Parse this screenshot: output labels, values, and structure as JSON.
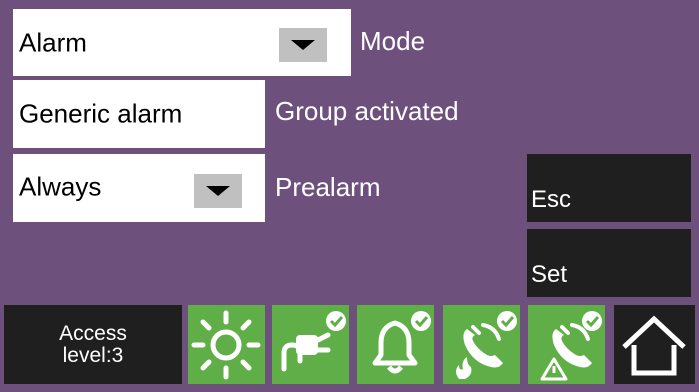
{
  "mode": {
    "value": "Alarm",
    "label": "Mode"
  },
  "group": {
    "value": "Generic alarm",
    "label": "Group activated"
  },
  "prealarm": {
    "value": "Always",
    "label": "Prealarm"
  },
  "buttons": {
    "esc": "Esc",
    "set": "Set"
  },
  "status": {
    "access_line1": "Access",
    "access_line2": "level:3",
    "icons": [
      "sun-icon",
      "power-plug-icon",
      "bell-icon",
      "phone-fire-icon",
      "phone-warning-icon",
      "home-icon"
    ]
  },
  "colors": {
    "background": "#6d517c",
    "status_green": "#5fae47",
    "dark_button": "#1f1f1f"
  }
}
